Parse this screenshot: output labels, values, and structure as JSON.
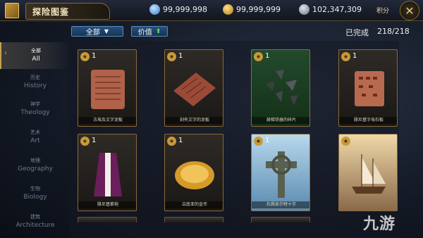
{
  "header": {
    "title": "探险图鉴",
    "resources": [
      {
        "icon": "diamond-icon",
        "value": "99,999,998"
      },
      {
        "icon": "gold-coin-icon",
        "value": "99,999,999"
      },
      {
        "icon": "silver-coin-icon",
        "value": "102,347,309"
      }
    ],
    "points_label": "积分"
  },
  "filters": {
    "all_label": "全部",
    "value_label": "价值"
  },
  "progress": {
    "label": "已完成",
    "count": "218/218"
  },
  "sidebar": {
    "items": [
      {
        "cn": "全部",
        "en": "All",
        "active": true
      },
      {
        "cn": "历史",
        "en": "History"
      },
      {
        "cn": "神学",
        "en": "Theology"
      },
      {
        "cn": "艺术",
        "en": "Art"
      },
      {
        "cn": "地理",
        "en": "Geography"
      },
      {
        "cn": "生物",
        "en": "Biology"
      },
      {
        "cn": "建筑",
        "en": "Architecture"
      }
    ]
  },
  "cards": [
    {
      "count": "1",
      "name": "古埃及文字泥板",
      "art": "clay-tablet"
    },
    {
      "count": "1",
      "name": "刻有文字的泥板",
      "art": "clay-tablet-red"
    },
    {
      "count": "1",
      "name": "赫梯铁器的碎片",
      "art": "iron-shards"
    },
    {
      "count": "1",
      "name": "腓尼基字母石板",
      "art": "stone-tablet"
    },
    {
      "count": "1",
      "name": "腓尼基紫袍",
      "art": "purple-robe"
    },
    {
      "count": "1",
      "name": "吕底亚的金币",
      "art": "gold-coin"
    },
    {
      "count": "1",
      "name": "石质凯尔特十字",
      "art": "celtic-cross"
    },
    {
      "count": "",
      "name": "",
      "art": "sailing-ship"
    }
  ],
  "colors": {
    "accent_gold": "#c8a050",
    "filter_blue": "#28507a"
  },
  "watermark": "九游"
}
